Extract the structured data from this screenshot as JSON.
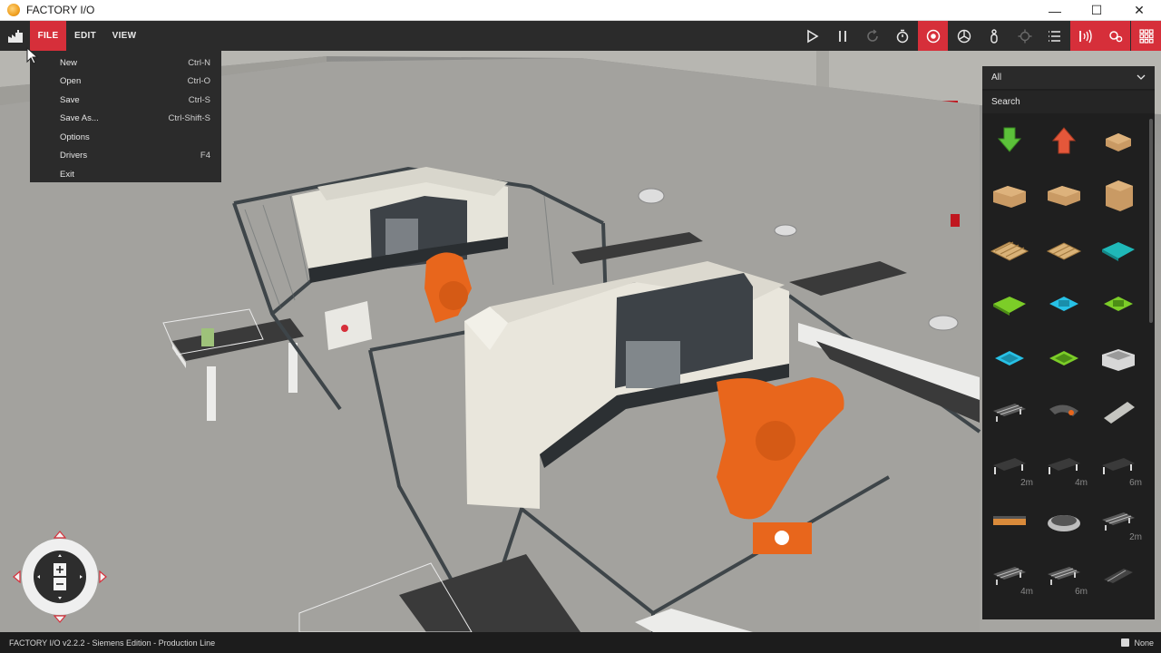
{
  "window": {
    "title": "FACTORY I/O",
    "minimize_glyph": "—",
    "maximize_glyph": "☐",
    "close_glyph": "✕"
  },
  "menu": {
    "tabs": [
      "FILE",
      "EDIT",
      "VIEW"
    ],
    "active_tab": "FILE"
  },
  "toolbar": {
    "buttons": [
      "play-icon",
      "pause-icon",
      "reset-icon",
      "timer-icon",
      "camera-orbit-icon",
      "fly-camera-icon",
      "first-person-icon",
      "selection-icon",
      "list-icon",
      "sensors-icon",
      "drivers-icon",
      "palette-icon"
    ]
  },
  "file_menu": {
    "items": [
      {
        "label": "New",
        "shortcut": "Ctrl-N"
      },
      {
        "label": "Open",
        "shortcut": "Ctrl-O"
      },
      {
        "label": "Save",
        "shortcut": "Ctrl-S"
      },
      {
        "label": "Save As...",
        "shortcut": "Ctrl-Shift-S"
      },
      {
        "label": "Options",
        "shortcut": ""
      },
      {
        "label": "Drivers",
        "shortcut": "F4"
      },
      {
        "label": "Exit",
        "shortcut": ""
      }
    ]
  },
  "panel": {
    "filter_value": "All",
    "search_label": "Search",
    "parts": [
      {
        "icon": "remover-icon",
        "length": ""
      },
      {
        "icon": "emitter-icon",
        "length": ""
      },
      {
        "icon": "small-box-icon",
        "length": ""
      },
      {
        "icon": "medium-box-icon",
        "length": ""
      },
      {
        "icon": "flat-box-icon",
        "length": ""
      },
      {
        "icon": "large-box-icon",
        "length": ""
      },
      {
        "icon": "pallet-icon",
        "length": ""
      },
      {
        "icon": "small-pallet-icon",
        "length": ""
      },
      {
        "icon": "teal-raw-material-icon",
        "length": ""
      },
      {
        "icon": "green-raw-material-icon",
        "length": ""
      },
      {
        "icon": "blue-base-icon",
        "length": ""
      },
      {
        "icon": "green-lid-icon",
        "length": ""
      },
      {
        "icon": "blue-product-base-icon",
        "length": ""
      },
      {
        "icon": "green-product-lid-icon",
        "length": ""
      },
      {
        "icon": "stackable-box-icon",
        "length": ""
      },
      {
        "icon": "roller-conveyor-icon",
        "length": ""
      },
      {
        "icon": "curved-conveyor-icon",
        "length": ""
      },
      {
        "icon": "metal-plate-icon",
        "length": ""
      },
      {
        "icon": "belt-conveyor-icon",
        "length": "2m"
      },
      {
        "icon": "belt-conveyor-icon",
        "length": "4m"
      },
      {
        "icon": "belt-conveyor-icon",
        "length": "6m"
      },
      {
        "icon": "chain-conveyor-icon",
        "length": ""
      },
      {
        "icon": "turntable-icon",
        "length": ""
      },
      {
        "icon": "roller-conveyor-icon",
        "length": "2m"
      },
      {
        "icon": "roller-conveyor-icon",
        "length": "4m"
      },
      {
        "icon": "roller-conveyor-icon",
        "length": "6m"
      },
      {
        "icon": "curved-roller-icon",
        "length": ""
      }
    ]
  },
  "status": {
    "text": "FACTORY I/O v2.2.2 - Siemens Edition - Production Line",
    "right_label": "None"
  },
  "colors": {
    "accent": "#d62f3a",
    "robot": "#e8661c",
    "machine": "#e9e6dc"
  }
}
